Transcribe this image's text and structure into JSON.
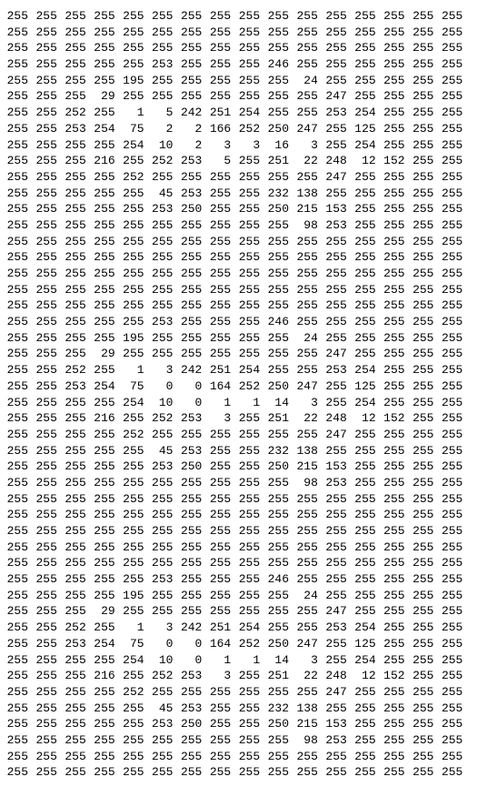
{
  "matrix": {
    "rows": [
      [
        255,
        255,
        255,
        255,
        255,
        255,
        255,
        255,
        255,
        255,
        255,
        255,
        255,
        255,
        255,
        255
      ],
      [
        255,
        255,
        255,
        255,
        255,
        255,
        255,
        255,
        255,
        255,
        255,
        255,
        255,
        255,
        255,
        255
      ],
      [
        255,
        255,
        255,
        255,
        255,
        255,
        255,
        255,
        255,
        255,
        255,
        255,
        255,
        255,
        255,
        255
      ],
      [
        255,
        255,
        255,
        255,
        255,
        253,
        255,
        255,
        255,
        246,
        255,
        255,
        255,
        255,
        255,
        255
      ],
      [
        255,
        255,
        255,
        255,
        195,
        255,
        255,
        255,
        255,
        255,
        24,
        255,
        255,
        255,
        255,
        255
      ],
      [
        255,
        255,
        255,
        29,
        255,
        255,
        255,
        255,
        255,
        255,
        255,
        247,
        255,
        255,
        255,
        255
      ],
      [
        255,
        255,
        252,
        255,
        1,
        5,
        242,
        251,
        254,
        255,
        255,
        253,
        254,
        255,
        255,
        255
      ],
      [
        255,
        255,
        253,
        254,
        75,
        2,
        2,
        166,
        252,
        250,
        247,
        255,
        125,
        255,
        255,
        255
      ],
      [
        255,
        255,
        255,
        255,
        254,
        10,
        2,
        3,
        3,
        16,
        3,
        255,
        254,
        255,
        255,
        255
      ],
      [
        255,
        255,
        255,
        216,
        255,
        252,
        253,
        5,
        255,
        251,
        22,
        248,
        12,
        152,
        255,
        255
      ],
      [
        255,
        255,
        255,
        255,
        252,
        255,
        255,
        255,
        255,
        255,
        255,
        247,
        255,
        255,
        255,
        255
      ],
      [
        255,
        255,
        255,
        255,
        255,
        45,
        253,
        255,
        255,
        232,
        138,
        255,
        255,
        255,
        255,
        255
      ],
      [
        255,
        255,
        255,
        255,
        255,
        253,
        250,
        255,
        255,
        250,
        215,
        153,
        255,
        255,
        255,
        255
      ],
      [
        255,
        255,
        255,
        255,
        255,
        255,
        255,
        255,
        255,
        255,
        98,
        253,
        255,
        255,
        255,
        255
      ],
      [
        255,
        255,
        255,
        255,
        255,
        255,
        255,
        255,
        255,
        255,
        255,
        255,
        255,
        255,
        255,
        255
      ],
      [
        255,
        255,
        255,
        255,
        255,
        255,
        255,
        255,
        255,
        255,
        255,
        255,
        255,
        255,
        255,
        255
      ],
      [
        255,
        255,
        255,
        255,
        255,
        255,
        255,
        255,
        255,
        255,
        255,
        255,
        255,
        255,
        255,
        255
      ],
      [
        255,
        255,
        255,
        255,
        255,
        255,
        255,
        255,
        255,
        255,
        255,
        255,
        255,
        255,
        255,
        255
      ],
      [
        255,
        255,
        255,
        255,
        255,
        255,
        255,
        255,
        255,
        255,
        255,
        255,
        255,
        255,
        255,
        255
      ],
      [
        255,
        255,
        255,
        255,
        255,
        253,
        255,
        255,
        255,
        246,
        255,
        255,
        255,
        255,
        255,
        255
      ],
      [
        255,
        255,
        255,
        255,
        195,
        255,
        255,
        255,
        255,
        255,
        24,
        255,
        255,
        255,
        255,
        255
      ],
      [
        255,
        255,
        255,
        29,
        255,
        255,
        255,
        255,
        255,
        255,
        255,
        247,
        255,
        255,
        255,
        255
      ],
      [
        255,
        255,
        252,
        255,
        1,
        3,
        242,
        251,
        254,
        255,
        255,
        253,
        254,
        255,
        255,
        255
      ],
      [
        255,
        255,
        253,
        254,
        75,
        0,
        0,
        164,
        252,
        250,
        247,
        255,
        125,
        255,
        255,
        255
      ],
      [
        255,
        255,
        255,
        255,
        254,
        10,
        0,
        1,
        1,
        14,
        3,
        255,
        254,
        255,
        255,
        255
      ],
      [
        255,
        255,
        255,
        216,
        255,
        252,
        253,
        3,
        255,
        251,
        22,
        248,
        12,
        152,
        255,
        255
      ],
      [
        255,
        255,
        255,
        255,
        252,
        255,
        255,
        255,
        255,
        255,
        255,
        247,
        255,
        255,
        255,
        255
      ],
      [
        255,
        255,
        255,
        255,
        255,
        45,
        253,
        255,
        255,
        232,
        138,
        255,
        255,
        255,
        255,
        255
      ],
      [
        255,
        255,
        255,
        255,
        255,
        253,
        250,
        255,
        255,
        250,
        215,
        153,
        255,
        255,
        255,
        255
      ],
      [
        255,
        255,
        255,
        255,
        255,
        255,
        255,
        255,
        255,
        255,
        98,
        253,
        255,
        255,
        255,
        255
      ],
      [
        255,
        255,
        255,
        255,
        255,
        255,
        255,
        255,
        255,
        255,
        255,
        255,
        255,
        255,
        255,
        255
      ],
      [
        255,
        255,
        255,
        255,
        255,
        255,
        255,
        255,
        255,
        255,
        255,
        255,
        255,
        255,
        255,
        255
      ],
      [
        255,
        255,
        255,
        255,
        255,
        255,
        255,
        255,
        255,
        255,
        255,
        255,
        255,
        255,
        255,
        255
      ],
      [
        255,
        255,
        255,
        255,
        255,
        255,
        255,
        255,
        255,
        255,
        255,
        255,
        255,
        255,
        255,
        255
      ],
      [
        255,
        255,
        255,
        255,
        255,
        255,
        255,
        255,
        255,
        255,
        255,
        255,
        255,
        255,
        255,
        255
      ],
      [
        255,
        255,
        255,
        255,
        255,
        253,
        255,
        255,
        255,
        246,
        255,
        255,
        255,
        255,
        255,
        255
      ],
      [
        255,
        255,
        255,
        255,
        195,
        255,
        255,
        255,
        255,
        255,
        24,
        255,
        255,
        255,
        255,
        255
      ],
      [
        255,
        255,
        255,
        29,
        255,
        255,
        255,
        255,
        255,
        255,
        255,
        247,
        255,
        255,
        255,
        255
      ],
      [
        255,
        255,
        252,
        255,
        1,
        3,
        242,
        251,
        254,
        255,
        255,
        253,
        254,
        255,
        255,
        255
      ],
      [
        255,
        255,
        253,
        254,
        75,
        0,
        0,
        164,
        252,
        250,
        247,
        255,
        125,
        255,
        255,
        255
      ],
      [
        255,
        255,
        255,
        255,
        254,
        10,
        0,
        1,
        1,
        14,
        3,
        255,
        254,
        255,
        255,
        255
      ],
      [
        255,
        255,
        255,
        216,
        255,
        252,
        253,
        3,
        255,
        251,
        22,
        248,
        12,
        152,
        255,
        255
      ],
      [
        255,
        255,
        255,
        255,
        252,
        255,
        255,
        255,
        255,
        255,
        255,
        247,
        255,
        255,
        255,
        255
      ],
      [
        255,
        255,
        255,
        255,
        255,
        45,
        253,
        255,
        255,
        232,
        138,
        255,
        255,
        255,
        255,
        255
      ],
      [
        255,
        255,
        255,
        255,
        255,
        253,
        250,
        255,
        255,
        250,
        215,
        153,
        255,
        255,
        255,
        255
      ],
      [
        255,
        255,
        255,
        255,
        255,
        255,
        255,
        255,
        255,
        255,
        98,
        253,
        255,
        255,
        255,
        255
      ],
      [
        255,
        255,
        255,
        255,
        255,
        255,
        255,
        255,
        255,
        255,
        255,
        255,
        255,
        255,
        255,
        255
      ],
      [
        255,
        255,
        255,
        255,
        255,
        255,
        255,
        255,
        255,
        255,
        255,
        255,
        255,
        255,
        255,
        255
      ]
    ]
  }
}
